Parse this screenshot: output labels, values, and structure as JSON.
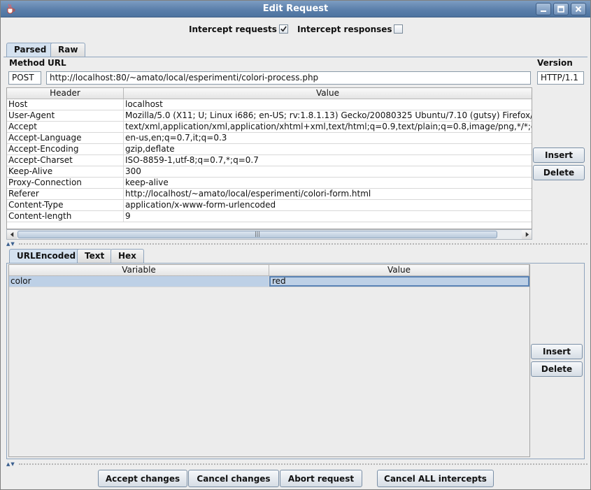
{
  "window": {
    "title": "Edit Request",
    "app_icon": "java-cup-icon"
  },
  "intercept": {
    "requests_label": "Intercept requests :",
    "requests_checked": true,
    "responses_label": "Intercept responses :",
    "responses_checked": false
  },
  "top_tabs": [
    {
      "label": "Parsed",
      "active": true
    },
    {
      "label": "Raw",
      "active": false
    }
  ],
  "request_line": {
    "method_label": "Method",
    "url_label": "URL",
    "version_label": "Version",
    "method": "POST",
    "url": "http://localhost:80/~amato/local/esperimenti/colori-process.php",
    "version": "HTTP/1.1"
  },
  "headers_table": {
    "columns": [
      "Header",
      "Value"
    ],
    "rows": [
      [
        "Host",
        "localhost"
      ],
      [
        "User-Agent",
        "Mozilla/5.0 (X11; U; Linux i686; en-US; rv:1.8.1.13) Gecko/20080325 Ubuntu/7.10 (gutsy) Firefox/"
      ],
      [
        "Accept",
        "text/xml,application/xml,application/xhtml+xml,text/html;q=0.9,text/plain;q=0.8,image/png,*/*;q"
      ],
      [
        "Accept-Language",
        "en-us,en;q=0.7,it;q=0.3"
      ],
      [
        "Accept-Encoding",
        "gzip,deflate"
      ],
      [
        "Accept-Charset",
        "ISO-8859-1,utf-8;q=0.7,*;q=0.7"
      ],
      [
        "Keep-Alive",
        "300"
      ],
      [
        "Proxy-Connection",
        "keep-alive"
      ],
      [
        "Referer",
        "http://localhost/~amato/local/esperimenti/colori-form.html"
      ],
      [
        "Content-Type",
        "application/x-www-form-urlencoded"
      ],
      [
        "Content-length",
        "9"
      ]
    ],
    "insert_label": "Insert",
    "delete_label": "Delete",
    "scroll_thumb_grip": "|||"
  },
  "body_tabs": [
    {
      "label": "URLEncoded",
      "active": true
    },
    {
      "label": "Text",
      "active": false
    },
    {
      "label": "Hex",
      "active": false
    }
  ],
  "vars_table": {
    "columns": [
      "Variable",
      "Value"
    ],
    "rows": [
      [
        "color",
        "red"
      ]
    ],
    "insert_label": "Insert",
    "delete_label": "Delete"
  },
  "actions": {
    "accept": "Accept changes",
    "cancel": "Cancel changes",
    "abort": "Abort request",
    "cancel_all": "Cancel ALL intercepts"
  }
}
